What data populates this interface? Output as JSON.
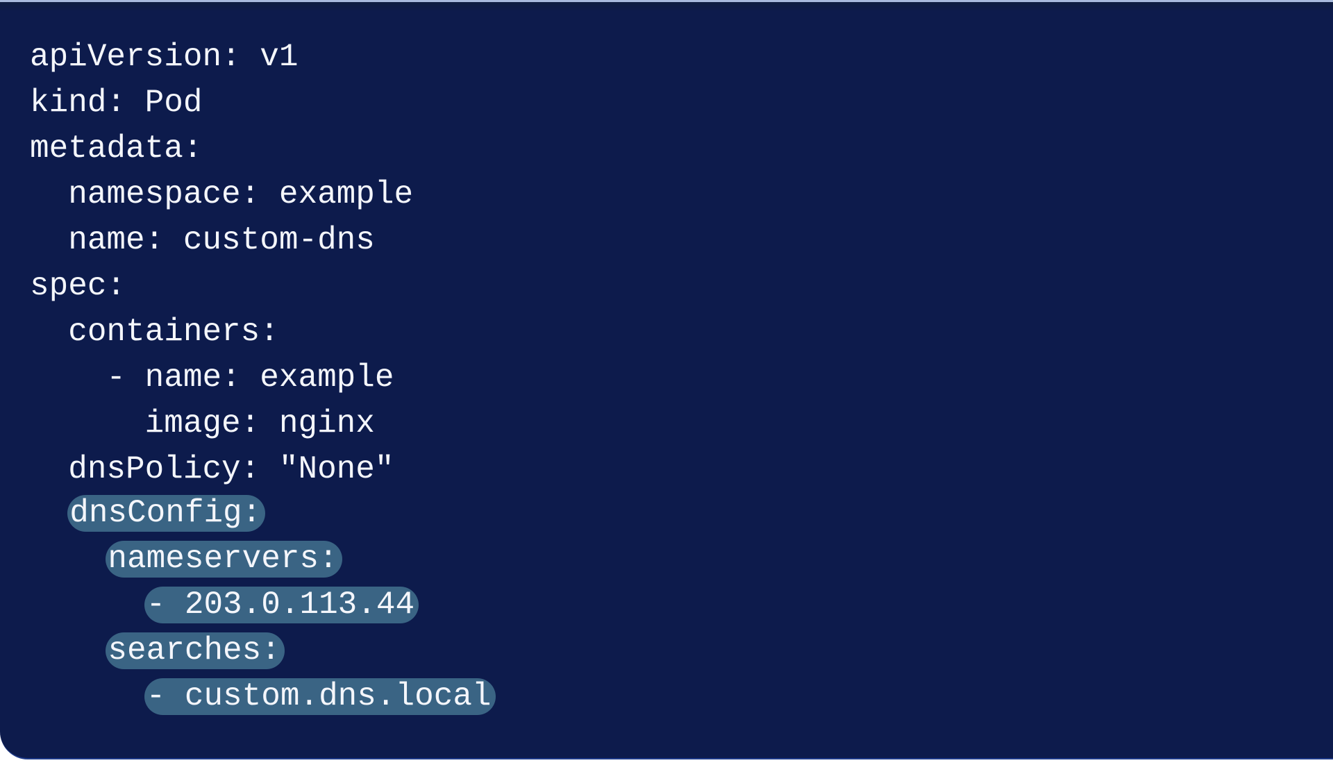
{
  "colors": {
    "background": "#0d1b4c",
    "text": "#f4f6fb",
    "highlight": "#3a6484",
    "top_border": "#a9bbdd"
  },
  "code_lines": [
    {
      "indent": "",
      "text": "apiVersion: v1",
      "highlighted": false
    },
    {
      "indent": "",
      "text": "kind: Pod",
      "highlighted": false
    },
    {
      "indent": "",
      "text": "metadata:",
      "highlighted": false
    },
    {
      "indent": "  ",
      "text": "namespace: example",
      "highlighted": false
    },
    {
      "indent": "  ",
      "text": "name: custom-dns",
      "highlighted": false
    },
    {
      "indent": "",
      "text": "spec:",
      "highlighted": false
    },
    {
      "indent": "  ",
      "text": "containers:",
      "highlighted": false
    },
    {
      "indent": "    ",
      "text": "- name: example",
      "highlighted": false
    },
    {
      "indent": "      ",
      "text": "image: nginx",
      "highlighted": false
    },
    {
      "indent": "  ",
      "text": "dnsPolicy: \"None\"",
      "highlighted": false
    },
    {
      "indent": "  ",
      "text": "dnsConfig:",
      "highlighted": true
    },
    {
      "indent": "    ",
      "text": "nameservers:",
      "highlighted": true
    },
    {
      "indent": "      ",
      "text": "- 203.0.113.44",
      "highlighted": true
    },
    {
      "indent": "    ",
      "text": "searches:",
      "highlighted": true
    },
    {
      "indent": "      ",
      "text": "- custom.dns.local",
      "highlighted": true
    }
  ]
}
